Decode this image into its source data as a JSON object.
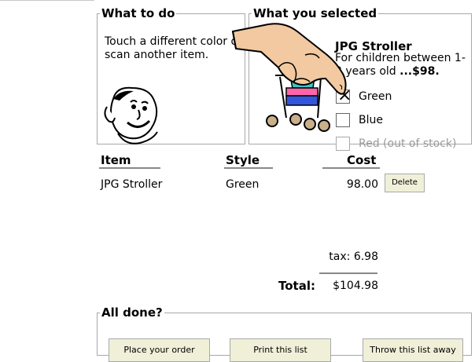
{
  "what_to_do": {
    "legend": "What to do",
    "message": "Touch a different color or scan another item."
  },
  "selected": {
    "legend": "What you selected",
    "product_name": "JPG Stroller",
    "description": "For children between 1-3 years old",
    "price": "...$98.",
    "options": [
      {
        "label": "Green",
        "checked": true,
        "disabled": false
      },
      {
        "label": "Blue",
        "checked": false,
        "disabled": false
      },
      {
        "label": "Red (out of stock)",
        "checked": false,
        "disabled": true
      }
    ]
  },
  "table": {
    "headers": {
      "item": "Item",
      "style": "Style",
      "cost": "Cost"
    },
    "rows": [
      {
        "item": "JPG Stroller",
        "style": "Green",
        "cost": "98.00",
        "delete_label": "Delete"
      }
    ]
  },
  "summary": {
    "tax_label": "tax:",
    "tax_value": "6.98",
    "total_label": "Total:",
    "total_value": "$104.98"
  },
  "all_done": {
    "legend": "All done?",
    "place_order": "Place your order",
    "print_list": "Print this list",
    "throw_away": "Throw this list away"
  },
  "colors": {
    "button_bg": "#f0efd8",
    "border": "#a8a8a8",
    "disabled_text": "#9a9a9a"
  }
}
